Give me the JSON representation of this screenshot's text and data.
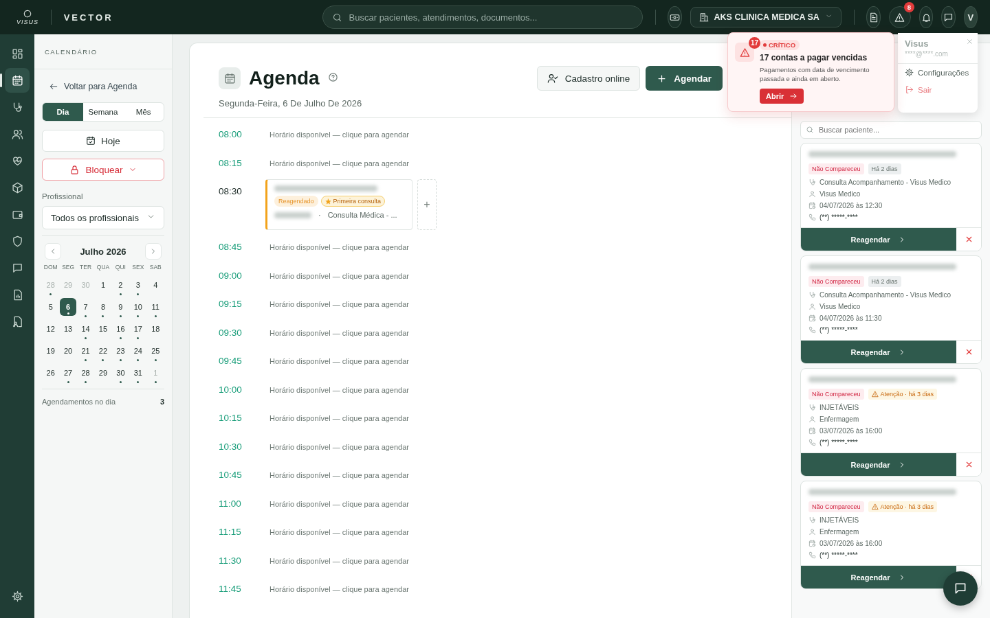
{
  "topbar": {
    "logo": "VISUS",
    "product": "VECTOR",
    "search": {
      "placeholder": "Buscar pacientes, atendimentos, documentos..."
    },
    "company": "AKS CLINICA MEDICA SA",
    "alert_badge": "8",
    "avatar": "V"
  },
  "rail": {
    "items": [
      {
        "selected": false
      },
      {
        "selected": true
      },
      {
        "selected": false
      },
      {
        "selected": false
      },
      {
        "selected": false
      },
      {
        "selected": false
      },
      {
        "selected": false
      },
      {
        "selected": false
      },
      {
        "selected": false
      },
      {
        "selected": false
      },
      {
        "selected": false
      }
    ]
  },
  "sidebar": {
    "title": "CALENDÁRIO",
    "back": "Voltar para Agenda",
    "views": [
      {
        "label": "Dia",
        "selected": true
      },
      {
        "label": "Semana",
        "selected": false
      },
      {
        "label": "Mês",
        "selected": false
      }
    ],
    "today": "Hoje",
    "block": "Bloquear",
    "professional_label": "Profissional",
    "professional": "Todos os profissionais",
    "month": "Julho 2026",
    "weekdays": [
      "DOM",
      "SEG",
      "TER",
      "QUA",
      "QUI",
      "SEX",
      "SAB"
    ],
    "weeks": [
      [
        {
          "day": "28",
          "muted": true,
          "dot": true,
          "selected": false
        },
        {
          "day": "29",
          "muted": true,
          "dot": false,
          "selected": false
        },
        {
          "day": "30",
          "muted": true,
          "dot": false,
          "selected": false
        },
        {
          "day": "1",
          "muted": false,
          "dot": false,
          "selected": false
        },
        {
          "day": "2",
          "muted": false,
          "dot": true,
          "selected": false
        },
        {
          "day": "3",
          "muted": false,
          "dot": true,
          "selected": false
        },
        {
          "day": "4",
          "muted": false,
          "dot": false,
          "selected": false
        }
      ],
      [
        {
          "day": "5",
          "muted": false,
          "dot": false,
          "selected": false
        },
        {
          "day": "6",
          "muted": false,
          "dot": true,
          "selected": true
        },
        {
          "day": "7",
          "muted": false,
          "dot": true,
          "selected": false
        },
        {
          "day": "8",
          "muted": false,
          "dot": true,
          "selected": false
        },
        {
          "day": "9",
          "muted": false,
          "dot": true,
          "selected": false
        },
        {
          "day": "10",
          "muted": false,
          "dot": true,
          "selected": false
        },
        {
          "day": "11",
          "muted": false,
          "dot": true,
          "selected": false
        }
      ],
      [
        {
          "day": "12",
          "muted": false,
          "dot": false,
          "selected": false
        },
        {
          "day": "13",
          "muted": false,
          "dot": false,
          "selected": false
        },
        {
          "day": "14",
          "muted": false,
          "dot": true,
          "selected": false
        },
        {
          "day": "15",
          "muted": false,
          "dot": false,
          "selected": false
        },
        {
          "day": "16",
          "muted": false,
          "dot": true,
          "selected": false
        },
        {
          "day": "17",
          "muted": false,
          "dot": true,
          "selected": false
        },
        {
          "day": "18",
          "muted": false,
          "dot": false,
          "selected": false
        }
      ],
      [
        {
          "day": "19",
          "muted": false,
          "dot": false,
          "selected": false
        },
        {
          "day": "20",
          "muted": false,
          "dot": false,
          "selected": false
        },
        {
          "day": "21",
          "muted": false,
          "dot": true,
          "selected": false
        },
        {
          "day": "22",
          "muted": false,
          "dot": true,
          "selected": false
        },
        {
          "day": "23",
          "muted": false,
          "dot": true,
          "selected": false
        },
        {
          "day": "24",
          "muted": false,
          "dot": true,
          "selected": false
        },
        {
          "day": "25",
          "muted": false,
          "dot": true,
          "selected": false
        }
      ],
      [
        {
          "day": "26",
          "muted": false,
          "dot": false,
          "selected": false
        },
        {
          "day": "27",
          "muted": false,
          "dot": true,
          "selected": false
        },
        {
          "day": "28",
          "muted": false,
          "dot": true,
          "selected": false
        },
        {
          "day": "29",
          "muted": false,
          "dot": false,
          "selected": false
        },
        {
          "day": "30",
          "muted": false,
          "dot": true,
          "selected": false
        },
        {
          "day": "31",
          "muted": false,
          "dot": true,
          "selected": false
        },
        {
          "day": "1",
          "muted": true,
          "dot": true,
          "selected": false
        }
      ]
    ],
    "count_label": "Agendamentos no dia",
    "count": "3"
  },
  "header": {
    "title": "Agenda",
    "date": "Segunda-Feira, 6 De Julho De 2026",
    "online_button": "Cadastro online",
    "new_button": "Agendar"
  },
  "slots": [
    {
      "time": "08:00",
      "kind": "available",
      "text": "Horário disponível — clique para agendar"
    },
    {
      "time": "08:15",
      "kind": "available",
      "text": "Horário disponível — clique para agendar"
    },
    {
      "time": "08:30",
      "kind": "appointment",
      "tags": [
        {
          "label": "Reagendado",
          "kind": "rescheduled"
        },
        {
          "label": "Primeira consulta",
          "kind": "first"
        }
      ],
      "separator": "·",
      "service": "Consulta Médica - ...",
      "add": "+"
    },
    {
      "time": "08:45",
      "kind": "available",
      "text": "Horário disponível — clique para agendar"
    },
    {
      "time": "09:00",
      "kind": "available",
      "text": "Horário disponível — clique para agendar"
    },
    {
      "time": "09:15",
      "kind": "available",
      "text": "Horário disponível — clique para agendar"
    },
    {
      "time": "09:30",
      "kind": "available",
      "text": "Horário disponível — clique para agendar"
    },
    {
      "time": "09:45",
      "kind": "available",
      "text": "Horário disponível — clique para agendar"
    },
    {
      "time": "10:00",
      "kind": "available",
      "text": "Horário disponível — clique para agendar"
    },
    {
      "time": "10:15",
      "kind": "available",
      "text": "Horário disponível — clique para agendar"
    },
    {
      "time": "10:30",
      "kind": "available",
      "text": "Horário disponível — clique para agendar"
    },
    {
      "time": "10:45",
      "kind": "available",
      "text": "Horário disponível — clique para agendar"
    },
    {
      "time": "11:00",
      "kind": "available",
      "text": "Horário disponível — clique para agendar"
    },
    {
      "time": "11:15",
      "kind": "available",
      "text": "Horário disponível — clique para agendar"
    },
    {
      "time": "11:30",
      "kind": "available",
      "text": "Horário disponível — clique para agendar"
    },
    {
      "time": "11:45",
      "kind": "available",
      "text": "Horário disponível — clique para agendar"
    }
  ],
  "missed_panel": {
    "search": {
      "placeholder": "Buscar paciente..."
    },
    "cards": [
      {
        "status": "Não Compareceu",
        "age": {
          "label": "Há 2 dias",
          "kind": "neutral"
        },
        "service": "Consulta Acompanhamento - Visus Medico",
        "professional": "Visus Medico",
        "datetime": "04/07/2026 às 12:30",
        "phone": "(**) *****-****",
        "action": "Reagendar"
      },
      {
        "status": "Não Compareceu",
        "age": {
          "label": "Há 2 dias",
          "kind": "neutral"
        },
        "service": "Consulta Acompanhamento - Visus Medico",
        "professional": "Visus Medico",
        "datetime": "04/07/2026 às 11:30",
        "phone": "(**) *****-****",
        "action": "Reagendar"
      },
      {
        "status": "Não Compareceu",
        "age": {
          "label": "Atenção · há 3 dias",
          "kind": "warning"
        },
        "service": "INJETÁVEIS",
        "professional": "Enfermagem",
        "datetime": "03/07/2026 às 16:00",
        "phone": "(**) *****-****",
        "action": "Reagendar"
      },
      {
        "status": "Não Compareceu",
        "age": {
          "label": "Atenção · há 3 dias",
          "kind": "warning"
        },
        "service": "INJETÁVEIS",
        "professional": "Enfermagem",
        "datetime": "03/07/2026 às 16:00",
        "phone": "(**) *****-****",
        "action": "Reagendar"
      }
    ]
  },
  "user_menu": {
    "name": "Visus",
    "email": "****@****.com",
    "items": [
      {
        "label": "Configurações",
        "kind": "settings"
      },
      {
        "label": "Sair",
        "kind": "logout"
      }
    ]
  },
  "alert_toast": {
    "count": "17",
    "level": "CRÍTICO",
    "title": "17 contas a pagar vencidas",
    "description": "Pagamentos com data de vencimento passada e ainda em aberto.",
    "action": "Abrir"
  }
}
